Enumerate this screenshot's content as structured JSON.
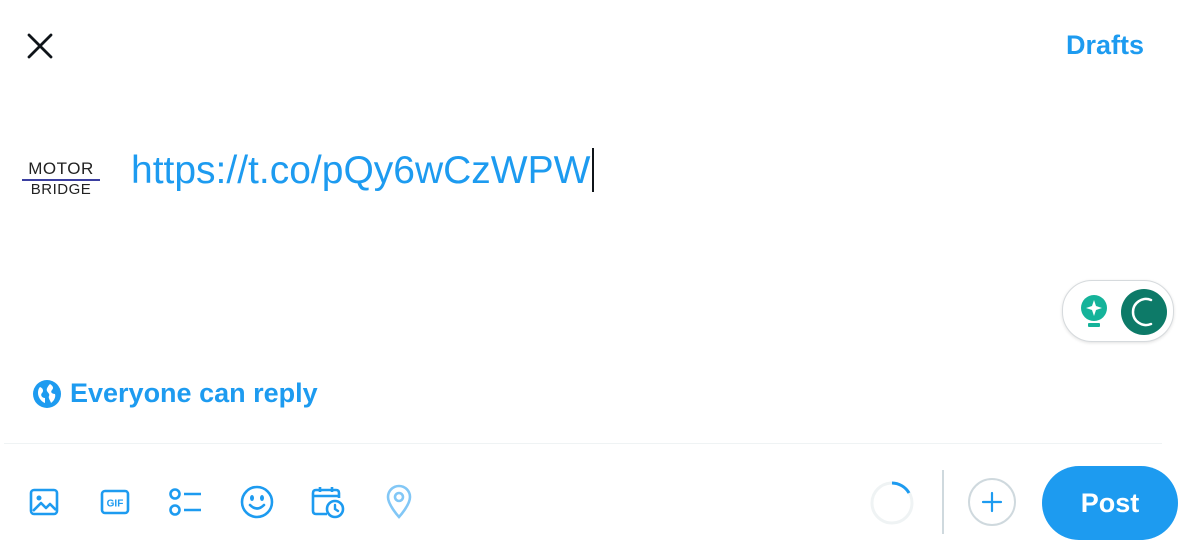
{
  "header": {
    "close_icon": "close-icon",
    "drafts_label": "Drafts"
  },
  "avatar": {
    "logo_top": "MOTOR",
    "logo_bottom": "BRIDGE"
  },
  "compose": {
    "text": "https://t.co/pQy6wCzWPW"
  },
  "grammar_widget": {
    "bulb_icon": "lightbulb-sparkle-icon",
    "logo_icon": "grammarly-g-icon",
    "color": "#0d7a68"
  },
  "reply_setting": {
    "icon": "globe-icon",
    "label": "Everyone can reply"
  },
  "toolbar": {
    "items": [
      {
        "icon": "image-icon"
      },
      {
        "icon": "gif-icon",
        "text": "GIF"
      },
      {
        "icon": "poll-icon"
      },
      {
        "icon": "emoji-icon"
      },
      {
        "icon": "schedule-icon"
      },
      {
        "icon": "location-icon"
      }
    ],
    "add_icon": "plus-icon",
    "post_label": "Post"
  },
  "colors": {
    "accent": "#1d9bf0",
    "text": "#0f1419",
    "border": "#cfd9de"
  }
}
